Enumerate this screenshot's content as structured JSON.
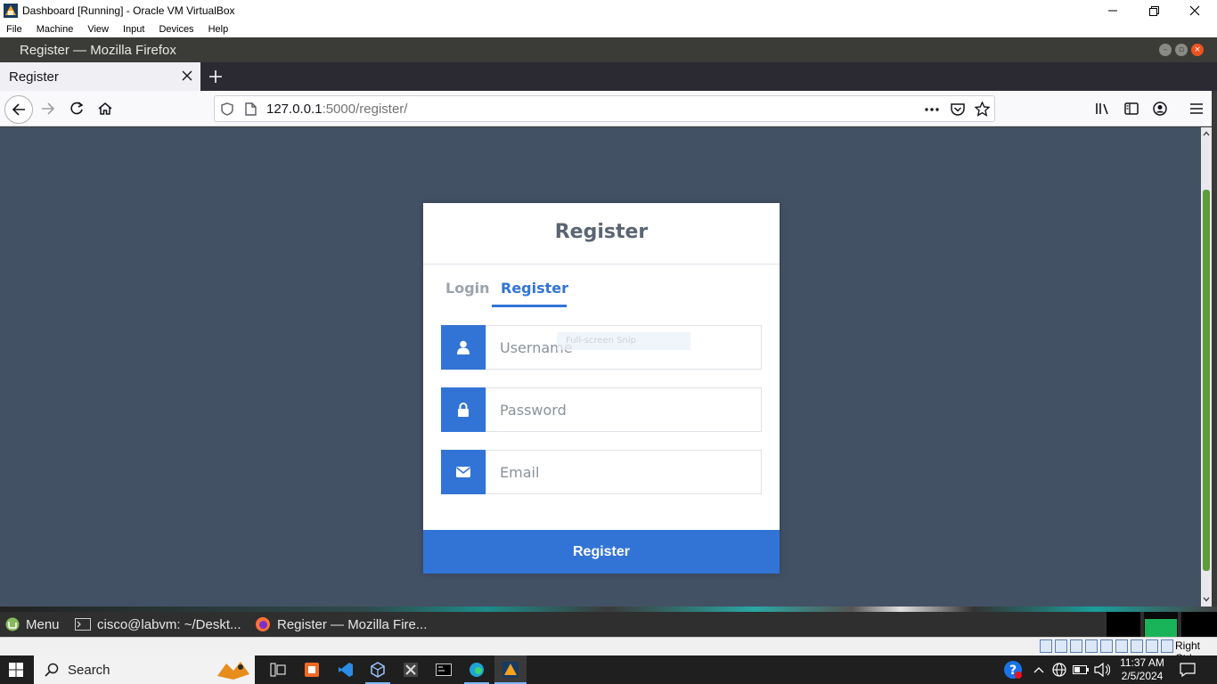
{
  "vbox": {
    "title": "Dashboard [Running] - Oracle VM VirtualBox",
    "menu": [
      "File",
      "Machine",
      "View",
      "Input",
      "Devices",
      "Help"
    ],
    "status_key": "Right Ctrl"
  },
  "firefox": {
    "window_title": "Register — Mozilla Firefox",
    "tab_title": "Register",
    "url_host": "127.0.0.1",
    "url_rest": ":5000/register/"
  },
  "form": {
    "heading": "Register",
    "tabs": [
      {
        "label": "Login",
        "active": false
      },
      {
        "label": "Register",
        "active": true
      }
    ],
    "fields": [
      {
        "icon": "user-icon",
        "placeholder": "Username",
        "value": ""
      },
      {
        "icon": "lock-icon",
        "placeholder": "Password",
        "value": ""
      },
      {
        "icon": "envelope-icon",
        "placeholder": "Email",
        "value": ""
      }
    ],
    "overlay_text": "Full-screen Snip",
    "submit_label": "Register"
  },
  "mint_panel": {
    "menu_label": "Menu",
    "windows": [
      "cisco@labvm: ~/Deskt...",
      "Register — Mozilla Fire..."
    ]
  },
  "taskbar": {
    "search_label": "Search",
    "time": "11:37 AM",
    "date": "2/5/2024"
  },
  "colors": {
    "page_bg": "#435165",
    "accent": "#3274d6",
    "card_bg": "#ffffff"
  }
}
